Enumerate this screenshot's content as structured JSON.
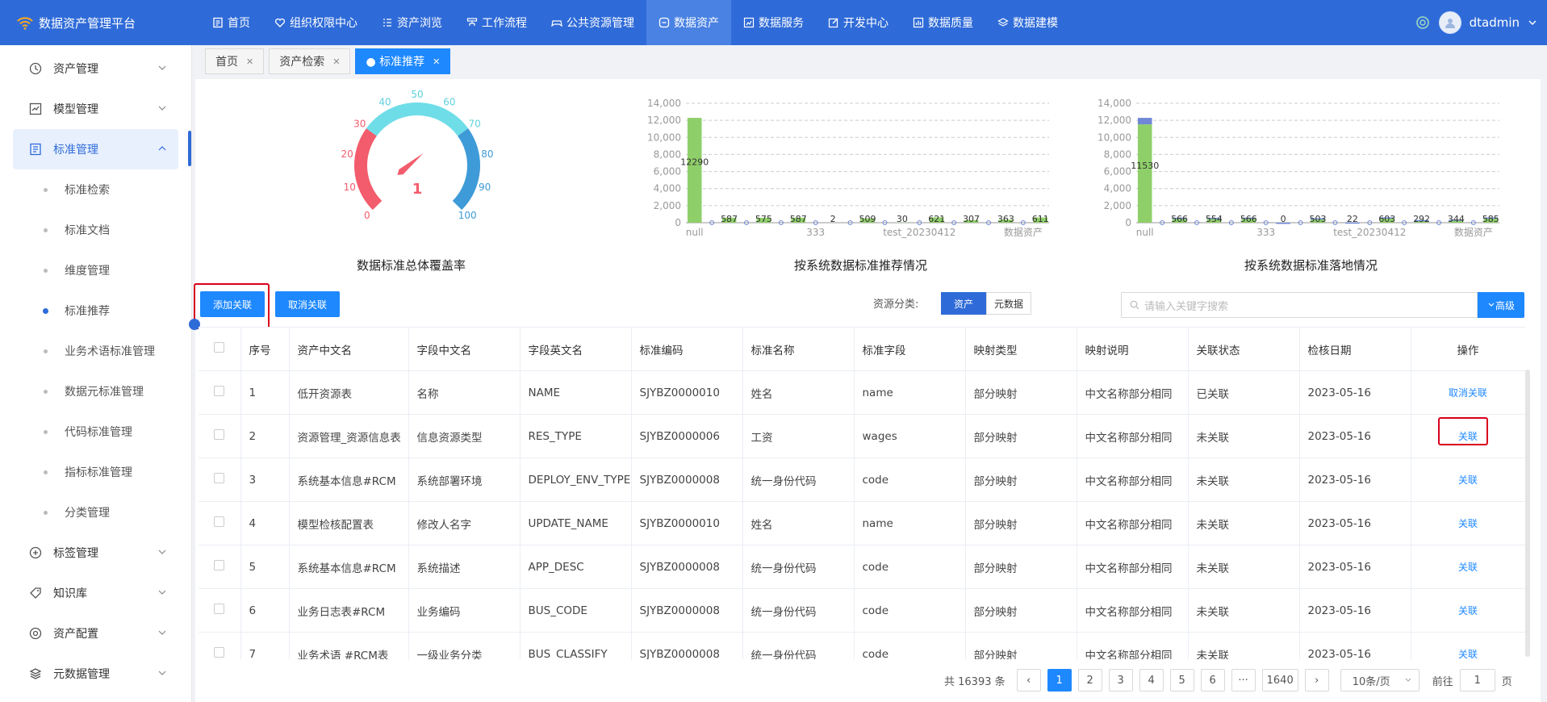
{
  "brand": "数据资产管理平台",
  "nav": [
    "首页",
    "组织权限中心",
    "资产浏览",
    "工作流程",
    "公共资源管理",
    "数据资产",
    "数据服务",
    "开发中心",
    "数据质量",
    "数据建模"
  ],
  "user": "dtadmin",
  "sidebar": {
    "groups_top": [
      "资产管理",
      "模型管理",
      "标准管理"
    ],
    "subs": [
      "标准检索",
      "标准文档",
      "维度管理",
      "标准推荐",
      "业务术语标准管理",
      "数据元标准管理",
      "代码标准管理",
      "指标标准管理",
      "分类管理"
    ],
    "groups_bottom": [
      "标签管理",
      "知识库",
      "资产配置",
      "元数据管理"
    ]
  },
  "tabs": [
    "首页",
    "资产检索",
    "● 标准推荐"
  ],
  "gauge": {
    "value": "1",
    "title": "数据标准总体覆盖率",
    "ticks": [
      "0",
      "10",
      "20",
      "30",
      "40",
      "50",
      "60",
      "70",
      "80",
      "90",
      "100"
    ],
    "fraction": 0.01
  },
  "chart_data": [
    {
      "type": "bar",
      "title": "按系统数据标准推荐情况",
      "ylim": [
        0,
        14000
      ],
      "yticks": [
        "0",
        "2,000",
        "4,000",
        "6,000",
        "8,000",
        "10,000",
        "12,000",
        "14,000"
      ],
      "xticks": [
        "null",
        "333",
        "test_20230412",
        "数据资产"
      ],
      "series": [
        {
          "values": [
            12290,
            0,
            587,
            0,
            575,
            0,
            587,
            0,
            2,
            0,
            509,
            0,
            30,
            0,
            621,
            0,
            307,
            0,
            363,
            0,
            611
          ]
        },
        {
          "values": [
            0,
            0,
            0,
            0,
            0,
            0,
            0,
            0,
            0,
            0,
            0,
            0,
            0,
            0,
            0,
            0,
            0,
            0,
            0,
            0,
            0
          ]
        }
      ]
    },
    {
      "type": "bar",
      "title": "按系统数据标准落地情况",
      "ylim": [
        0,
        14000
      ],
      "yticks": [
        "0",
        "2,000",
        "4,000",
        "6,000",
        "8,000",
        "10,000",
        "12,000",
        "14,000"
      ],
      "xticks": [
        "null",
        "333",
        "test_20230412",
        "数据资产"
      ],
      "series": [
        {
          "values": [
            11530,
            0,
            566,
            0,
            554,
            0,
            566,
            0,
            0,
            0,
            503,
            0,
            22,
            0,
            603,
            0,
            292,
            0,
            344,
            0,
            585
          ]
        },
        {
          "values": [
            760,
            0,
            21,
            0,
            21,
            0,
            21,
            0,
            2,
            0,
            6,
            0,
            8,
            0,
            18,
            0,
            15,
            0,
            19,
            0,
            26
          ]
        }
      ]
    }
  ],
  "buttons": {
    "add": "添加关联",
    "cancel": "取消关联"
  },
  "filter": {
    "label": "资源分类:",
    "opt1": "资产",
    "opt2": "元数据"
  },
  "search": {
    "placeholder": "请输入关键字搜索",
    "adv": "高级"
  },
  "table": {
    "headers": [
      "序号",
      "资产中文名",
      "字段中文名",
      "字段英文名",
      "标准编码",
      "标准名称",
      "标准字段",
      "映射类型",
      "映射说明",
      "关联状态",
      "检核日期",
      "操作"
    ],
    "rows": [
      [
        "1",
        "低开资源表",
        "名称",
        "NAME",
        "SJYBZ0000010",
        "姓名",
        "name",
        "部分映射",
        "中文名称部分相同",
        "已关联",
        "2023-05-16",
        "取消关联"
      ],
      [
        "2",
        "资源管理_资源信息表",
        "信息资源类型",
        "RES_TYPE",
        "SJYBZ0000006",
        "工资",
        "wages",
        "部分映射",
        "中文名称部分相同",
        "未关联",
        "2023-05-16",
        "关联"
      ],
      [
        "3",
        "系统基本信息#RCM",
        "系统部署环境",
        "DEPLOY_ENV_TYPE",
        "SJYBZ0000008",
        "统一身份代码",
        "code",
        "部分映射",
        "中文名称部分相同",
        "未关联",
        "2023-05-16",
        "关联"
      ],
      [
        "4",
        "模型检核配置表",
        "修改人名字",
        "UPDATE_NAME",
        "SJYBZ0000010",
        "姓名",
        "name",
        "部分映射",
        "中文名称部分相同",
        "未关联",
        "2023-05-16",
        "关联"
      ],
      [
        "5",
        "系统基本信息#RCM",
        "系统描述",
        "APP_DESC",
        "SJYBZ0000008",
        "统一身份代码",
        "code",
        "部分映射",
        "中文名称部分相同",
        "未关联",
        "2023-05-16",
        "关联"
      ],
      [
        "6",
        "业务日志表#RCM",
        "业务编码",
        "BUS_CODE",
        "SJYBZ0000008",
        "统一身份代码",
        "code",
        "部分映射",
        "中文名称部分相同",
        "未关联",
        "2023-05-16",
        "关联"
      ],
      [
        "7",
        "业务术语 #RCM表",
        "一级业务分类",
        "BUS_CLASSIFY",
        "SJYBZ0000008",
        "统一身份代码",
        "code",
        "部分映射",
        "中文名称部分相同",
        "未关联",
        "2023-05-16",
        "关联"
      ]
    ]
  },
  "pager": {
    "total": "共 16393 条",
    "pages": [
      "1",
      "2",
      "3",
      "4",
      "5",
      "6",
      "···",
      "1640"
    ],
    "size": "10条/页",
    "jump_label": "前往",
    "jump_value": "1",
    "jump_suffix": "页"
  },
  "colors": {
    "primary": "#1e88ff",
    "topbar": "#2f6bd8",
    "bar_green": "#8fcf6a",
    "bar_blue": "#6f87d6",
    "highlight": "#d9001b"
  }
}
